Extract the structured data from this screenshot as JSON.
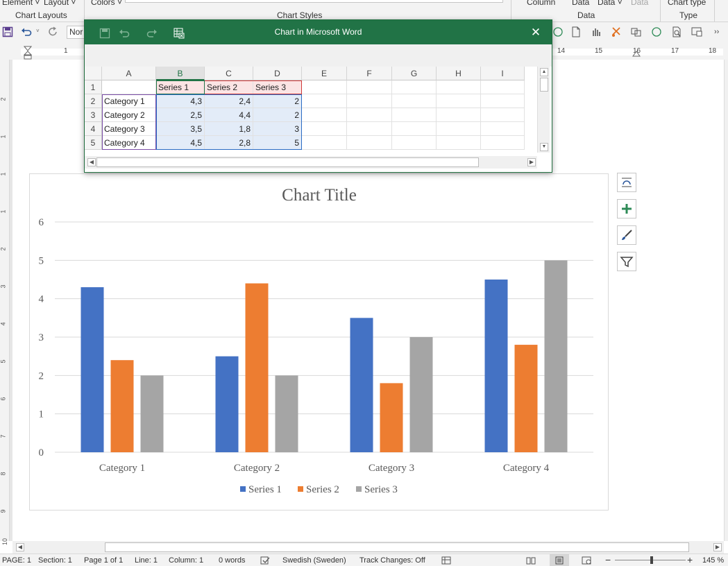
{
  "ribbon": {
    "add_element": "Element",
    "layout": "Layout",
    "chart_layouts": "Chart Layouts",
    "colors": "Colors",
    "chart_styles": "Chart Styles",
    "column": "Column",
    "data_switch": "Data",
    "data_select": "Data",
    "data_refresh": "Data",
    "data_group": "Data",
    "chart_type": "Chart type",
    "type_group": "Type"
  },
  "qat": {
    "style_value": "Nor"
  },
  "ruler": {
    "numbers_left": [
      "1"
    ],
    "numbers_right": [
      "14",
      "15",
      "16",
      "17",
      "18"
    ]
  },
  "vruler": {
    "numbers": [
      "2",
      "1",
      "1",
      "1",
      "2",
      "3",
      "4",
      "5",
      "6",
      "7",
      "8",
      "9",
      "10"
    ]
  },
  "data_window": {
    "title": "Chart in Microsoft Word",
    "columns": [
      "A",
      "B",
      "C",
      "D",
      "E",
      "F",
      "G",
      "H",
      "I"
    ],
    "rows": [
      "1",
      "2",
      "3",
      "4",
      "5"
    ],
    "cells": [
      [
        "",
        "Series 1",
        "Series 2",
        "Series 3"
      ],
      [
        "Category 1",
        "4,3",
        "2,4",
        "2"
      ],
      [
        "Category 2",
        "2,5",
        "4,4",
        "2"
      ],
      [
        "Category 3",
        "3,5",
        "1,8",
        "3"
      ],
      [
        "Category 4",
        "4,5",
        "2,8",
        "5"
      ]
    ]
  },
  "chart_data": {
    "type": "bar",
    "title": "Chart Title",
    "categories": [
      "Category 1",
      "Category 2",
      "Category 3",
      "Category 4"
    ],
    "series": [
      {
        "name": "Series 1",
        "values": [
          4.3,
          2.5,
          3.5,
          4.5
        ],
        "color": "#4472C4"
      },
      {
        "name": "Series 2",
        "values": [
          2.4,
          4.4,
          1.8,
          2.8
        ],
        "color": "#ED7D31"
      },
      {
        "name": "Series 3",
        "values": [
          2,
          2,
          3,
          5
        ],
        "color": "#A5A5A5"
      }
    ],
    "ylim": [
      0,
      6
    ],
    "yticks": [
      "0",
      "1",
      "2",
      "3",
      "4",
      "5",
      "6"
    ],
    "grid": true,
    "legend": "bottom"
  },
  "status": {
    "page": "PAGE: 1",
    "section": "Section: 1",
    "page_of": "Page 1 of 1",
    "line": "Line: 1",
    "column": "Column: 1",
    "words": "0 words",
    "language": "Swedish (Sweden)",
    "track_changes": "Track Changes: Off",
    "zoom": "145 %"
  },
  "colors": {
    "excel_green": "#217346",
    "series1": "#4472C4",
    "series2": "#ED7D31",
    "series3": "#A5A5A5"
  }
}
